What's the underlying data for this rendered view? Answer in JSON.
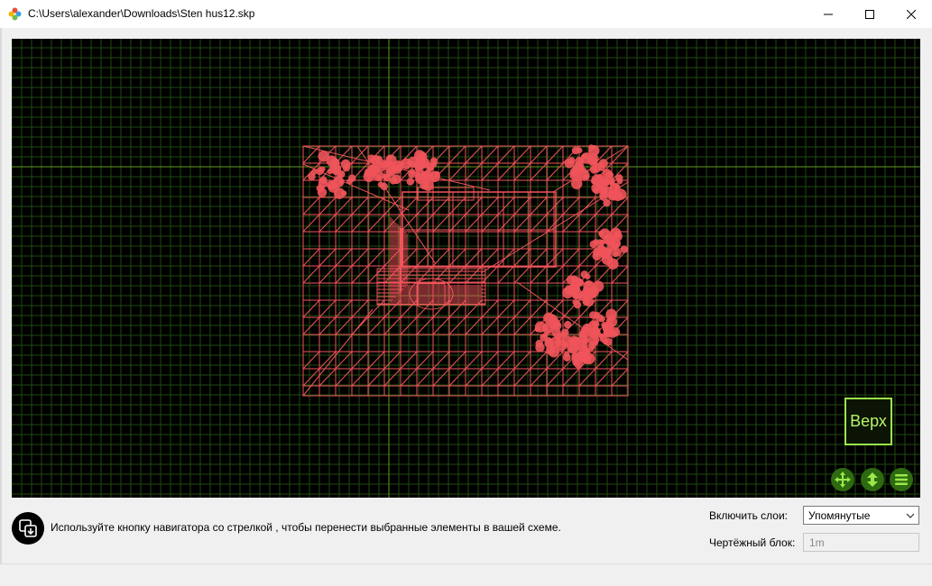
{
  "window": {
    "title": "C:\\Users\\alexander\\Downloads\\Sten hus12.skp",
    "controls": [
      "minimize",
      "maximize",
      "close"
    ]
  },
  "viewport": {
    "background": "#000000",
    "grid_color": "#1f4a10",
    "axis_color": "#5f9a1e",
    "drawing_color": "#f0545a",
    "view_label": "Верх",
    "nav_buttons": [
      "move-icon",
      "rotate-icon",
      "menu-icon"
    ]
  },
  "hint": {
    "icon": "transfer-icon",
    "text": "Используйте кнопку навигатора со стрелкой , чтобы перенести выбранные элементы в вашей схеме."
  },
  "options": {
    "layers_label": "Включить слои:",
    "layers_value": "Упомянутые",
    "block_label": "Чертёжный блок:",
    "block_value": "1m"
  }
}
